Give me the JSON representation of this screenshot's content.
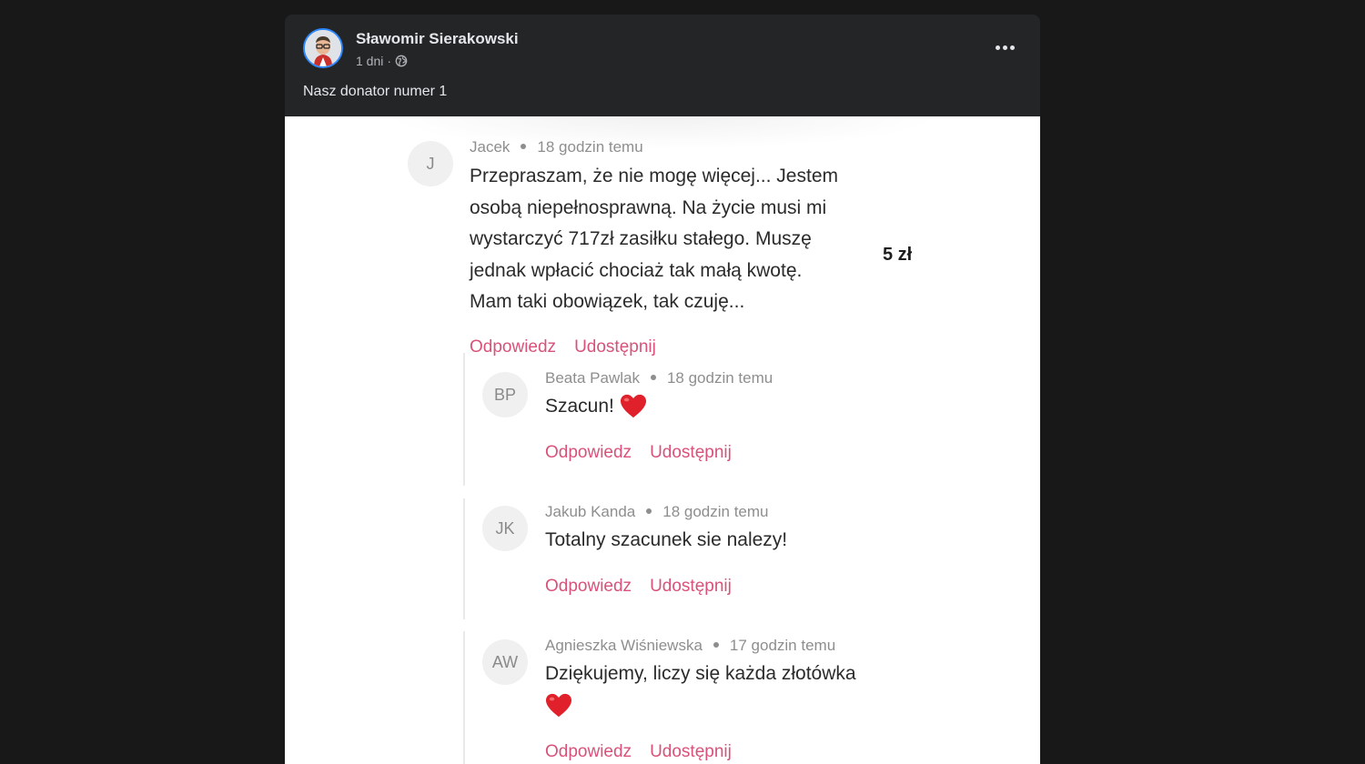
{
  "post": {
    "author": "Sławomir Sierakowski",
    "time": "1 dni",
    "visibility_icon": "globe-icon",
    "separator": "·",
    "text": "Nasz donator numer 1",
    "more_icon": "more-options-icon"
  },
  "screenshot": {
    "main_comment": {
      "initials": "J",
      "name": "Jacek",
      "time": "18 godzin temu",
      "lines": [
        "Przepraszam, że nie mogę więcej... Jestem",
        "osobą niepełnosprawną. Na życie musi mi",
        "wystarczyć 717zł zasiłku stałego. Muszę",
        "jednak wpłacić chociaż tak małą kwotę.",
        "Mam taki obowiązek, tak czuję..."
      ],
      "amount": "5 zł",
      "reply_label": "Odpowiedz",
      "share_label": "Udostępnij"
    },
    "replies": [
      {
        "initials": "BP",
        "name": "Beata Pawlak",
        "time": "18 godzin temu",
        "text": "Szacun! ",
        "reply_label": "Odpowiedz",
        "share_label": "Udostępnij"
      },
      {
        "initials": "JK",
        "name": "Jakub Kanda",
        "time": "18 godzin temu",
        "text": "Totalny szacunek sie nalezy!",
        "reply_label": "Odpowiedz",
        "share_label": "Udostępnij"
      },
      {
        "initials": "AW",
        "name": "Agnieszka Wiśniewska",
        "time": "17 godzin temu",
        "text": "Dziękujemy, liczy się każda złotówka",
        "reply_label": "Odpowiedz",
        "share_label": "Udostępnij"
      }
    ]
  },
  "colors": {
    "background": "#181818",
    "card": "#242526",
    "action_pink": "#d8527a",
    "heart_red": "#e0202a"
  }
}
